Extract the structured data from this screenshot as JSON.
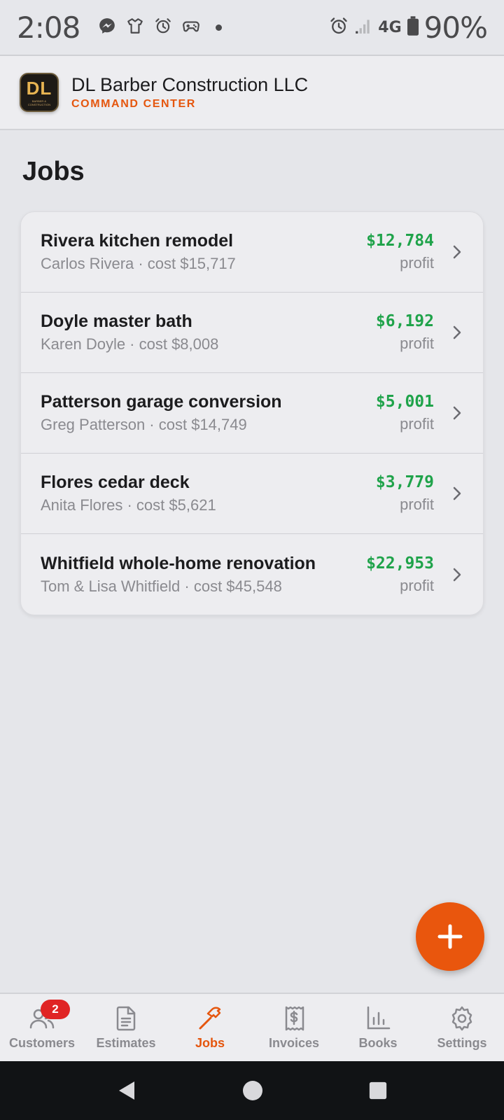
{
  "status_bar": {
    "time": "2:08",
    "network": "4G",
    "battery": "90%",
    "left_icons": [
      "messenger-icon",
      "shirt-icon",
      "alarm-icon",
      "gamepad-icon",
      "dot-icon"
    ],
    "right_icons": [
      "alarm-icon",
      "signal-icon",
      "battery-icon"
    ]
  },
  "header": {
    "logo_text": "DL",
    "logo_subtext": "BARBER & CONSTRUCTION",
    "company_name": "DL Barber Construction LLC",
    "subtitle": "COMMAND CENTER"
  },
  "page": {
    "title": "Jobs"
  },
  "jobs": [
    {
      "name": "Rivera kitchen remodel",
      "client_cost": "Carlos Rivera · cost $15,717",
      "profit": "$12,784",
      "profit_label": "profit"
    },
    {
      "name": "Doyle master bath",
      "client_cost": "Karen Doyle · cost $8,008",
      "profit": "$6,192",
      "profit_label": "profit"
    },
    {
      "name": "Patterson garage conversion",
      "client_cost": "Greg Patterson · cost $14,749",
      "profit": "$5,001",
      "profit_label": "profit"
    },
    {
      "name": "Flores cedar deck",
      "client_cost": "Anita Flores · cost $5,621",
      "profit": "$3,779",
      "profit_label": "profit"
    },
    {
      "name": "Whitfield whole-home renovation",
      "client_cost": "Tom & Lisa Whitfield · cost $45,548",
      "profit": "$22,953",
      "profit_label": "profit"
    }
  ],
  "fab": {
    "icon": "plus-icon"
  },
  "bottom_nav": {
    "items": [
      {
        "label": "Customers",
        "icon": "users-icon",
        "badge": "2"
      },
      {
        "label": "Estimates",
        "icon": "document-icon"
      },
      {
        "label": "Jobs",
        "icon": "hammer-icon",
        "active": true
      },
      {
        "label": "Invoices",
        "icon": "receipt-icon"
      },
      {
        "label": "Books",
        "icon": "bar-chart-icon"
      },
      {
        "label": "Settings",
        "icon": "gear-icon"
      }
    ]
  },
  "colors": {
    "accent": "#e5560e",
    "profit": "#1fa34a",
    "badge": "#e02424"
  }
}
